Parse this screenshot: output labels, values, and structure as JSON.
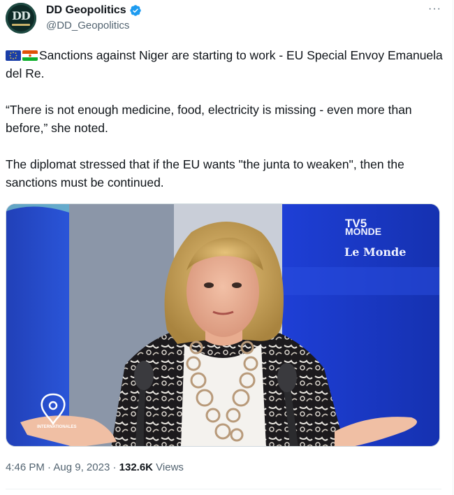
{
  "author": {
    "display_name": "DD Geopolitics",
    "handle": "@DD_Geopolitics",
    "avatar_text": "DD",
    "verified": true
  },
  "more_label": "···",
  "tweet": {
    "flags": [
      "eu-flag-icon",
      "niger-flag-icon"
    ],
    "paragraph1": "Sanctions against Niger are starting to work - EU Special Envoy Emanuela del Re.",
    "paragraph2": "“There is not enough medicine, food, electricity is missing - even more than before,” she noted.",
    "paragraph3": "The diplomat stressed that if the EU wants \"the junta to weaken\", then the sanctions must be continued."
  },
  "media": {
    "logo_tv5": "TV5",
    "logo_monde": "MONDE",
    "logo_lemonde": "Le Monde",
    "program_label": "INTERNATIONALES"
  },
  "meta": {
    "time": "4:46 PM",
    "sep1": " · ",
    "date": "Aug 9, 2023",
    "sep2": " · ",
    "views_count": "132.6K",
    "views_label": " Views"
  },
  "colors": {
    "verified": "#1d9bf0",
    "studio_blue": "#1b3fd0",
    "text_primary": "#0f1419",
    "text_secondary": "#536471"
  }
}
